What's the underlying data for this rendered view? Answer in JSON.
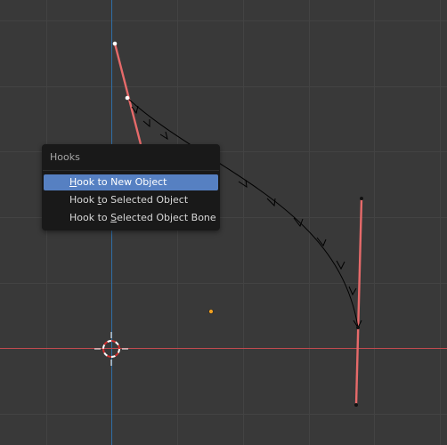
{
  "menu": {
    "title": "Hooks",
    "items": [
      {
        "name": "hook-to-new-object",
        "pre": "",
        "key": "H",
        "post": "ook to New Object",
        "active": true
      },
      {
        "name": "hook-to-selected-object",
        "pre": "Hook ",
        "key": "t",
        "post": "o Selected Object",
        "active": false
      },
      {
        "name": "hook-to-selected-object-bone",
        "pre": "Hook to ",
        "key": "S",
        "post": "elected Object Bone",
        "active": false
      }
    ]
  },
  "colors": {
    "background": "#393939",
    "grid": "#434343",
    "x_axis": "#c14a4f",
    "y_axis": "#2f6ea6",
    "handle_line": "#e66a6a",
    "curve": "#000000",
    "menu_bg": "#191919",
    "menu_highlight": "#5680c2",
    "origin_dot": "#f0a020"
  }
}
